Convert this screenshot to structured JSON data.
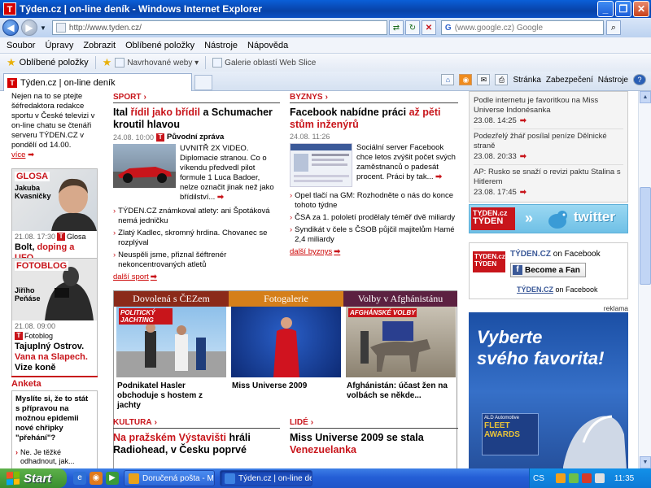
{
  "window": {
    "title": "Týden.cz | on-line deník - Windows Internet Explorer",
    "app_icon_letter": "T"
  },
  "address_bar": {
    "url": "http://www.tyden.cz/",
    "search_placeholder": "(www.google.cz) Google",
    "search_engine_letter": "G"
  },
  "menu": [
    "Soubor",
    "Úpravy",
    "Zobrazit",
    "Oblíbené položky",
    "Nástroje",
    "Nápověda"
  ],
  "favorites_bar": {
    "favorites_label": "Oblíbené položky",
    "links": [
      "Navrhované weby",
      "Galerie oblastí Web Slice"
    ]
  },
  "tabs": {
    "active_tab": "Týden.cz | on-line deník"
  },
  "command_bar": {
    "page": "Stránka",
    "security": "Zabezpečení",
    "tools": "Nástroje"
  },
  "left_column": {
    "lead_text": "Nejen na to se ptejte šéfredaktora redakce sportu v České televizi v on-line chatu se čtenáři serveru TÝDEN.CZ v pondělí od 14.00.",
    "lead_more": "více",
    "glosa": {
      "label": "GLOSA",
      "name": "Jakuba Kvasničky",
      "meta_time": "21.08. 17:30",
      "meta_section": "Glosa",
      "title_plain": "Bolt,",
      "title_red": "doping a UFO"
    },
    "fotoblog": {
      "label": "FOTOBLOG",
      "name": "Jiřího Peňáse",
      "meta_time": "21.08. 09:00",
      "meta_section": "Fotoblog",
      "title_plain_1": "Tajuplný Ostrov.",
      "title_red": "Vana na Slapech.",
      "title_plain_2": "Vize koně"
    },
    "anketa": {
      "label": "Anketa",
      "question": "Myslíte si, že to stát s přípravou na možnou epidemii nové chřipky \"přehání\"?",
      "option": "Ne. Je těžké odhadnout, jak..."
    }
  },
  "sport": {
    "section": "SPORT",
    "headline_p1": "Ital",
    "headline_red": "řídil jako břídil",
    "headline_p2": "a Schumacher kroutil hlavou",
    "meta_time": "24.08. 10:00",
    "meta_label": "Původní zpráva",
    "story": "UVNITŘ 2X VIDEO. Diplomacie stranou. Co o víkendu předvedl pilot formule 1 Luca Badoer, nelze označit jinak než jako břídilství...",
    "bullets": [
      "TÝDEN.CZ známkoval atlety: ani Špotáková nemá jedničku",
      "Zlatý Kadlec, skromný hrdina. Chovanec se rozplýval",
      "Neuspěli jsme, přiznal šéftrenér nekoncentrovaných atletů"
    ],
    "more": "další sport"
  },
  "byznys": {
    "section": "BYZNYS",
    "headline_p1": "Facebook nabídne práci",
    "headline_red": "až pěti stům inženýrů",
    "meta_time": "24.08. 11:26",
    "story": "Sociální server Facebook chce letos zvýšit počet svých zaměstnanců o padesát procent. Práci by tak...",
    "bullets": [
      "Opel tlačí na GM: Rozhodněte o nás do konce tohoto týdne",
      "ČSA za 1. pololetí prodělaly téměř dvě miliardy",
      "Syndikát v čele s ČSOB půjčil majitelům Hamé 2,4 miliardy"
    ],
    "more": "další byznys"
  },
  "gallery": {
    "tabs": [
      {
        "label": "Dovolená s ČEZem",
        "color": "#8b2a1a"
      },
      {
        "label": "Fotogalerie",
        "color": "#d57f1a"
      },
      {
        "label": "Volby v Afghánistánu",
        "color": "#5c2141"
      }
    ],
    "tiles": [
      {
        "tag": "POLITICKÝ JACHTING",
        "caption": "Podnikatel Hasler obchoduje s hostem z jachty"
      },
      {
        "tag": "",
        "caption": "Miss Universe 2009"
      },
      {
        "tag": "AFGHÁNSKÉ VOLBY",
        "caption": "Afghánistán: účast žen na volbách se někde..."
      }
    ]
  },
  "kultura": {
    "section": "KULTURA",
    "headline_red": "Na pražském Výstavišti",
    "headline_p2": "hráli Radiohead, v Česku poprvé"
  },
  "lide": {
    "section": "LIDÉ",
    "headline_p1": "Miss Universe 2009 se stala",
    "headline_red": "Venezuelanka"
  },
  "right_column": {
    "news": [
      {
        "title": "Podle internetu je favoritkou na Miss Universe Indonésanka",
        "date": "23.08. 14:25"
      },
      {
        "title": "Podezřelý žhář posílal peníze Dělnické straně",
        "date": "23.08. 20:33"
      },
      {
        "title": "AP: Rusko se snaží o revizi paktu Stalina s Hitlerem",
        "date": "23.08. 17:45"
      }
    ],
    "twitter": {
      "brand_top": "TYDEN.cz",
      "brand_bottom": "TÝDEN",
      "word": "twitter"
    },
    "facebook": {
      "brand": "TÝDEN.CZ",
      "on_facebook": "on Facebook",
      "button": "Become a Fan",
      "footer_link": "TÝDEN.CZ",
      "footer_text": "on Facebook",
      "logo_top": "TYDEN.cz",
      "logo_bottom": "TÝDEN"
    },
    "ad_label": "reklama",
    "ad": {
      "headline_1": "Vyberte",
      "headline_2": "svého favorita!",
      "ald": "ALD Automotive",
      "fleet": "FLEET",
      "awards": "AWARDS"
    }
  },
  "taskbar": {
    "start": "Start",
    "tasks": [
      "Doručená pošta - Mic...",
      "Týden.cz | on-line de..."
    ],
    "lang": "CS",
    "clock": "11:35"
  }
}
